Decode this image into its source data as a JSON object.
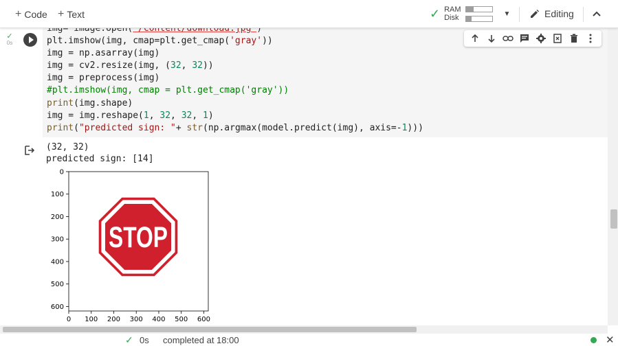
{
  "toolbar": {
    "add_code_label": "Code",
    "add_text_label": "Text",
    "ram_label": "RAM",
    "disk_label": "Disk",
    "ram_usage": 0.3,
    "disk_usage": 0.22,
    "editing_label": "Editing"
  },
  "cell": {
    "exec_time": "0s",
    "code_lines": [
      "img= image.open('/content/download.jpg')",
      "plt.imshow(img, cmap=plt.get_cmap('gray'))",
      "img = np.asarray(img)",
      "img = cv2.resize(img, (32, 32))",
      "img = preprocess(img)",
      "#plt.imshow(img, cmap = plt.get_cmap('gray'))",
      "print(img.shape)",
      "img = img.reshape(1, 32, 32, 1)",
      "print(\"predicted sign: \"+ str(np.argmax(model.predict(img), axis=-1)))"
    ],
    "tool_icons": [
      "arrow-up-icon",
      "arrow-down-icon",
      "link-icon",
      "comment-icon",
      "settings-icon",
      "mirror-cell-icon",
      "delete-icon",
      "more-icon"
    ]
  },
  "output": {
    "lines": [
      "(32, 32)",
      "predicted sign: [14]"
    ],
    "plot": {
      "x_ticks": [
        "0",
        "100",
        "200",
        "300",
        "400",
        "500",
        "600"
      ],
      "y_ticks": [
        "0",
        "100",
        "200",
        "300",
        "400",
        "500",
        "600"
      ],
      "image_text": "STOP",
      "sign_color": "#d0202e"
    }
  },
  "status": {
    "time": "0s",
    "message": "completed at 18:00"
  }
}
